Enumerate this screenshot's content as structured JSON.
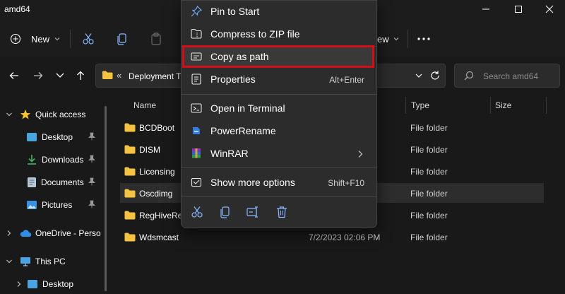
{
  "window": {
    "title": "amd64"
  },
  "toolbar": {
    "new_label": "New",
    "view_label": "ew"
  },
  "address": {
    "prefix": "«",
    "path": "Deployment T"
  },
  "search": {
    "placeholder": "Search amd64"
  },
  "nav": {
    "items": [
      {
        "label": "Quick access",
        "icon": "star-icon"
      },
      {
        "label": "Desktop",
        "icon": "desktop-icon",
        "pinned": true
      },
      {
        "label": "Downloads",
        "icon": "download-icon",
        "pinned": true
      },
      {
        "label": "Documents",
        "icon": "document-icon",
        "pinned": true
      },
      {
        "label": "Pictures",
        "icon": "picture-icon",
        "pinned": true
      },
      {
        "label": "OneDrive - Perso",
        "icon": "cloud-icon"
      },
      {
        "label": "This PC",
        "icon": "pc-icon"
      },
      {
        "label": "Desktop",
        "icon": "desktop-icon"
      }
    ]
  },
  "columns": {
    "name": "Name",
    "type": "Type",
    "size": "Size"
  },
  "files": [
    {
      "name": "BCDBoot",
      "date": "",
      "type": "File folder"
    },
    {
      "name": "DISM",
      "date": "",
      "type": "File folder"
    },
    {
      "name": "Licensing",
      "date": "",
      "type": "File folder"
    },
    {
      "name": "Oscdimg",
      "date": "",
      "type": "File folder",
      "selected": true
    },
    {
      "name": "RegHiveRe",
      "date": "",
      "type": "File folder"
    },
    {
      "name": "Wdsmcast",
      "date": "7/2/2023 02:06 PM",
      "type": "File folder"
    }
  ],
  "context_menu": {
    "items": [
      {
        "label": "Pin to Start",
        "icon": "pin-icon",
        "accel": ""
      },
      {
        "label": "Compress to ZIP file",
        "icon": "zip-icon",
        "accel": ""
      },
      {
        "label": "Copy as path",
        "icon": "copy-path-icon",
        "accel": "",
        "highlighted": true
      },
      {
        "label": "Properties",
        "icon": "properties-icon",
        "accel": "Alt+Enter"
      },
      {
        "label": "Open in Terminal",
        "icon": "terminal-icon",
        "accel": ""
      },
      {
        "label": "PowerRename",
        "icon": "powerrename-icon",
        "accel": ""
      },
      {
        "label": "WinRAR",
        "icon": "winrar-icon",
        "accel": "",
        "submenu": true
      },
      {
        "label": "Show more options",
        "icon": "more-options-icon",
        "accel": "Shift+F10"
      }
    ],
    "bottom_icons": [
      "cut-icon",
      "copy-icon",
      "rename-icon",
      "delete-icon"
    ]
  },
  "colors": {
    "highlight_border": "#d20f16",
    "accent_blue": "#3b8eea",
    "folder_yellow": "#f5c242"
  }
}
